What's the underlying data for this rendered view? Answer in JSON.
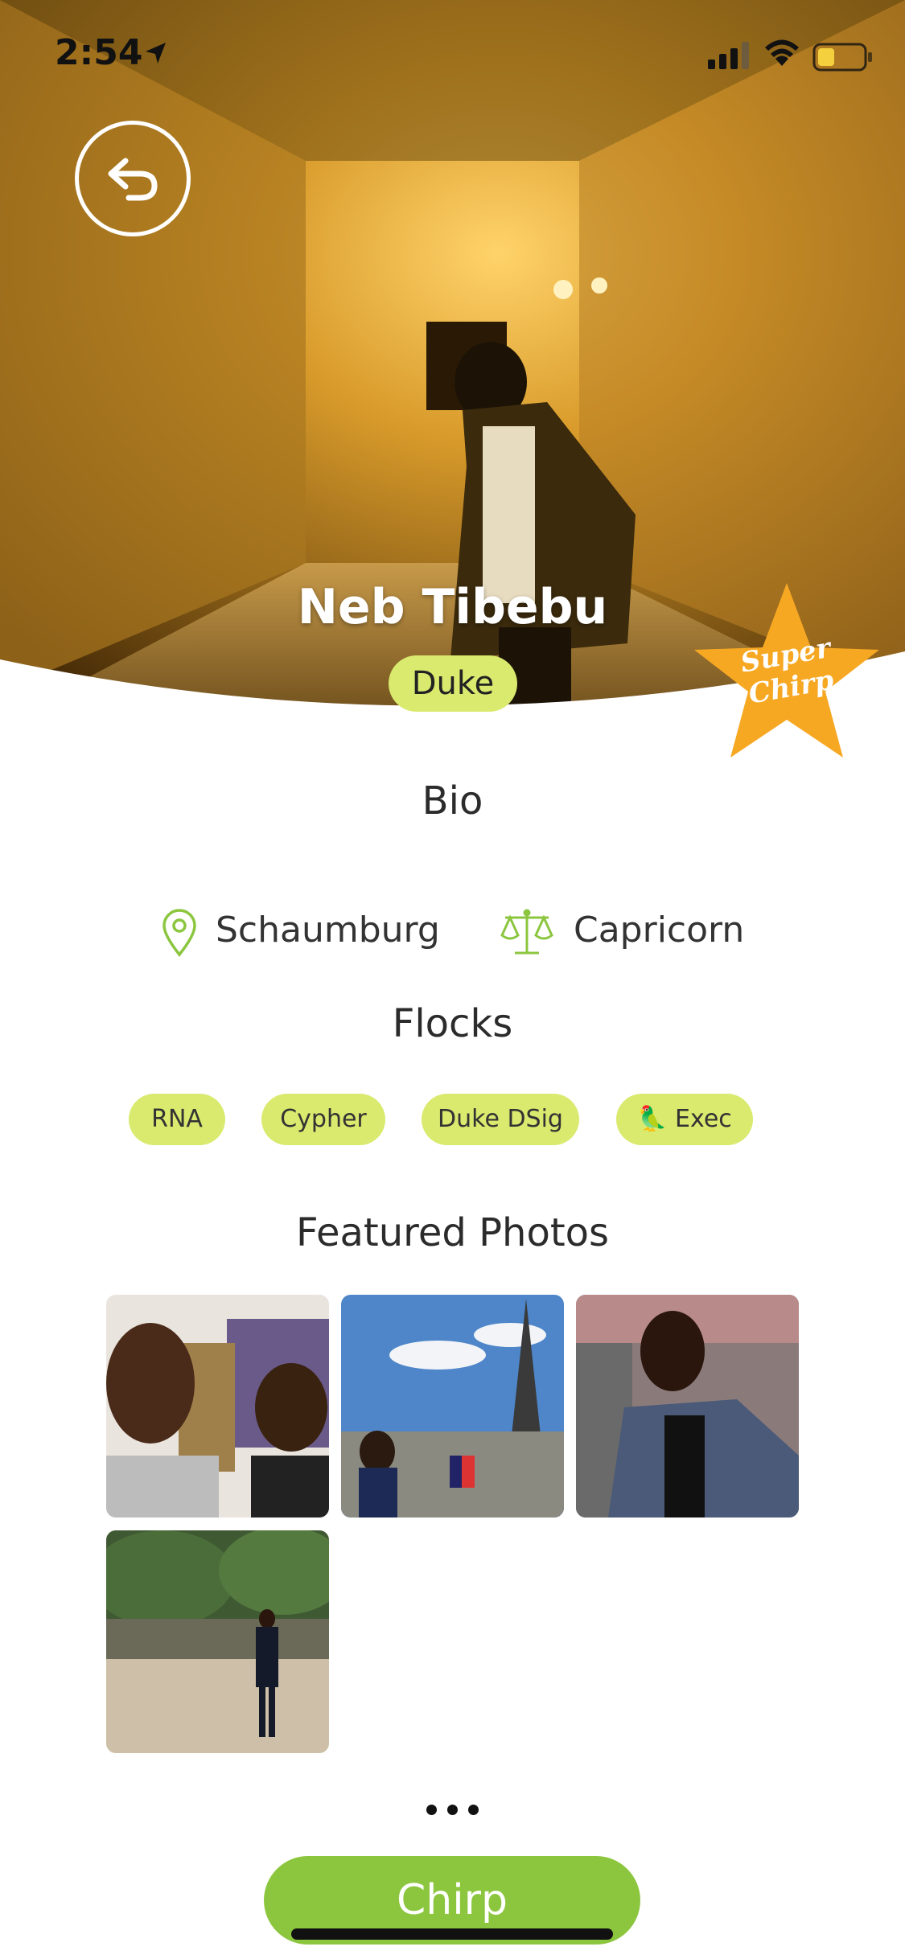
{
  "status_bar": {
    "time": "2:54"
  },
  "profile": {
    "name": "Neb Tibebu",
    "school": "Duke",
    "badge_line1": "Super",
    "badge_line2": "Chirp"
  },
  "bio": {
    "title": "Bio",
    "location": "Schaumburg",
    "zodiac": "Capricorn"
  },
  "flocks": {
    "title": "Flocks",
    "items": [
      "RNA",
      "Cypher",
      "Duke DSig",
      "🦜 Exec"
    ]
  },
  "photos": {
    "title": "Featured Photos",
    "count": 4
  },
  "more_label": "...",
  "chirp_button": "Chirp",
  "colors": {
    "accent_green": "#8cc63f",
    "tag_yellow_green": "#d9ea6e",
    "star_orange": "#f7a823"
  }
}
